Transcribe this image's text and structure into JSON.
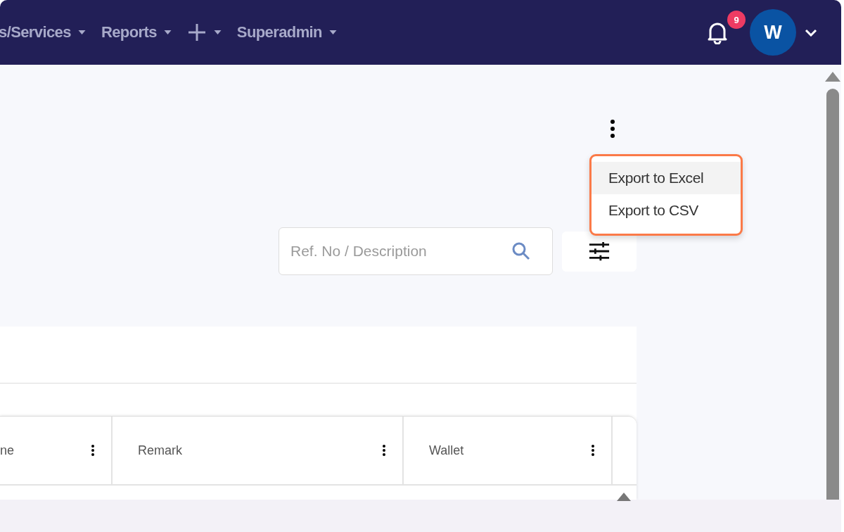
{
  "nav": {
    "items": [
      {
        "kind": "text",
        "label": "s/Services"
      },
      {
        "kind": "text",
        "label": "Reports"
      },
      {
        "kind": "plus"
      },
      {
        "kind": "text",
        "label": "Superadmin"
      }
    ]
  },
  "notifications": {
    "count": "9"
  },
  "user": {
    "initial": "W"
  },
  "export_menu": {
    "items": [
      {
        "label": "Export to Excel",
        "selected": true
      },
      {
        "label": "Export to CSV",
        "selected": false
      }
    ]
  },
  "search": {
    "placeholder": "Ref. No / Description"
  },
  "table": {
    "columns": [
      "ne",
      "Remark",
      "Wallet"
    ]
  }
}
